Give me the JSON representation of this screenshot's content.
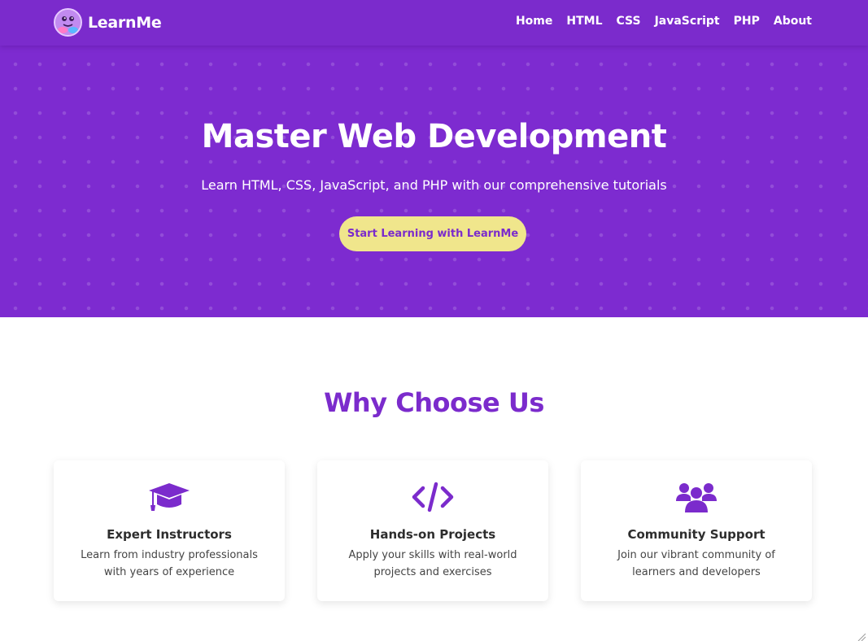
{
  "nav": {
    "brand": "LearnMe",
    "links": [
      "Home",
      "HTML",
      "CSS",
      "JavaScript",
      "PHP",
      "About"
    ]
  },
  "hero": {
    "title": "Master Web Development",
    "subtitle": "Learn HTML, CSS, JavaScript, and PHP with our comprehensive tutorials",
    "cta": "Start Learning with LearnMe"
  },
  "why": {
    "title": "Why Choose Us",
    "cards": [
      {
        "icon": "graduation-cap-icon",
        "title": "Expert Instructors",
        "description": "Learn from industry professionals with years of experience"
      },
      {
        "icon": "code-icon",
        "title": "Hands-on Projects",
        "description": "Apply your skills with real-world projects and exercises"
      },
      {
        "icon": "users-icon",
        "title": "Community Support",
        "description": "Join our vibrant community of learners and developers"
      }
    ]
  },
  "colors": {
    "primary": "#7b2bcc",
    "accent": "#f0e68c",
    "text": "#2d2d2d"
  }
}
